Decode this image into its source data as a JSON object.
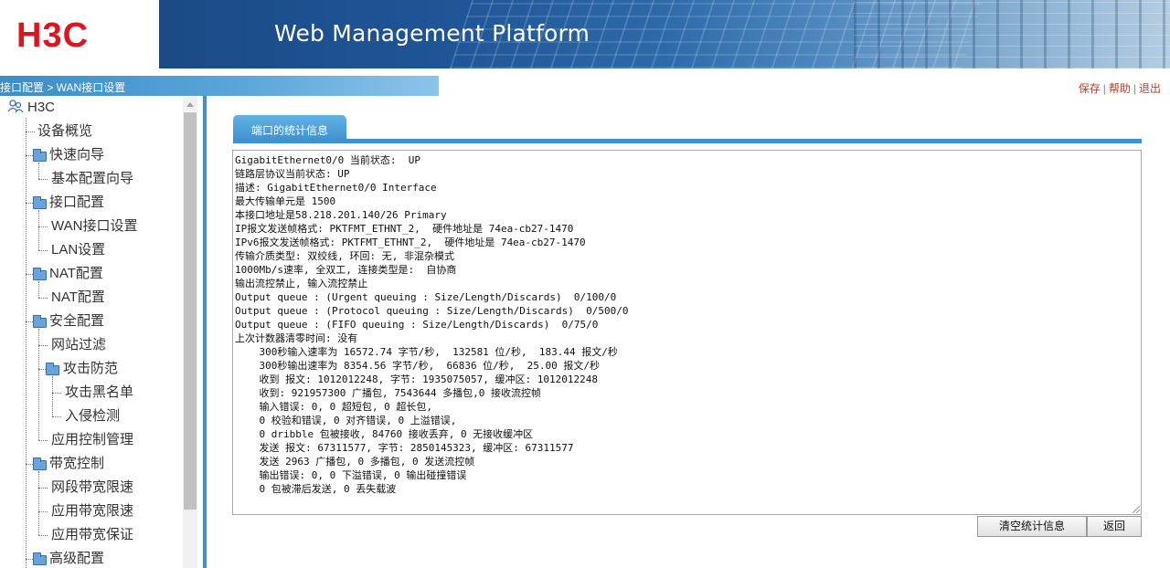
{
  "header": {
    "logo": "H3C",
    "title": "Web Management Platform"
  },
  "breadcrumb": "接口配置 > WAN接口设置",
  "top_links": {
    "save": "保存",
    "help": "帮助",
    "logout": "退出"
  },
  "sidebar": {
    "root": "H3C",
    "items": [
      {
        "label": "设备概览"
      },
      {
        "label": "快速向导"
      },
      {
        "label": "基本配置向导"
      },
      {
        "label": "接口配置"
      },
      {
        "label": "WAN接口设置"
      },
      {
        "label": "LAN设置"
      },
      {
        "label": "NAT配置"
      },
      {
        "label": "NAT配置"
      },
      {
        "label": "安全配置"
      },
      {
        "label": "网站过滤"
      },
      {
        "label": "攻击防范"
      },
      {
        "label": "攻击黑名单"
      },
      {
        "label": "入侵检测"
      },
      {
        "label": "应用控制管理"
      },
      {
        "label": "带宽控制"
      },
      {
        "label": "网段带宽限速"
      },
      {
        "label": "应用带宽限速"
      },
      {
        "label": "应用带宽保证"
      },
      {
        "label": "高级配置"
      }
    ]
  },
  "main": {
    "tab_label": "端口的统计信息",
    "stats_lines": [
      "GigabitEthernet0/0 当前状态:  UP",
      "链路层协议当前状态: UP",
      "描述: GigabitEthernet0/0 Interface",
      "最大传输单元是 1500",
      "本接口地址是58.218.201.140/26 Primary",
      "IP报文发送帧格式: PKTFMT_ETHNT_2,  硬件地址是 74ea-cb27-1470",
      "IPv6报文发送帧格式: PKTFMT_ETHNT_2,  硬件地址是 74ea-cb27-1470",
      "传输介质类型: 双绞线, 环回: 无, 非混杂模式",
      "1000Mb/s速率, 全双工, 连接类型是:  自协商",
      "输出流控禁止, 输入流控禁止",
      "Output queue : (Urgent queuing : Size/Length/Discards)  0/100/0",
      "Output queue : (Protocol queuing : Size/Length/Discards)  0/500/0",
      "Output queue : (FIFO queuing : Size/Length/Discards)  0/75/0",
      "上次计数器清零时间: 没有",
      "    300秒输入速率为 16572.74 字节/秒,  132581 位/秒,  183.44 报文/秒",
      "    300秒输出速率为 8354.56 字节/秒,  66836 位/秒,  25.00 报文/秒",
      "    收到 报文: 1012012248, 字节: 1935075057, 缓冲区: 1012012248",
      "    收到: 921957300 广播包, 7543644 多播包,0 接收流控帧",
      "    输入错误: 0, 0 超短包, 0 超长包,",
      "    0 校验和错误, 0 对齐错误, 0 上溢错误,",
      "    0 dribble 包被接收, 84760 接收丢弃, 0 无接收缓冲区",
      "    发送 报文: 67311577, 字节: 2850145323, 缓冲区: 67311577",
      "    发送 2963 广播包, 0 多播包, 0 发送流控帧",
      "    输出错误: 0, 0 下溢错误, 0 输出碰撞错误",
      "    0 包被滞后发送, 0 丢失载波"
    ],
    "buttons": {
      "clear": "清空统计信息",
      "back": "返回"
    }
  },
  "colors": {
    "accent": "#3e92d1",
    "logo": "#e0141e",
    "link": "#b8412a"
  }
}
